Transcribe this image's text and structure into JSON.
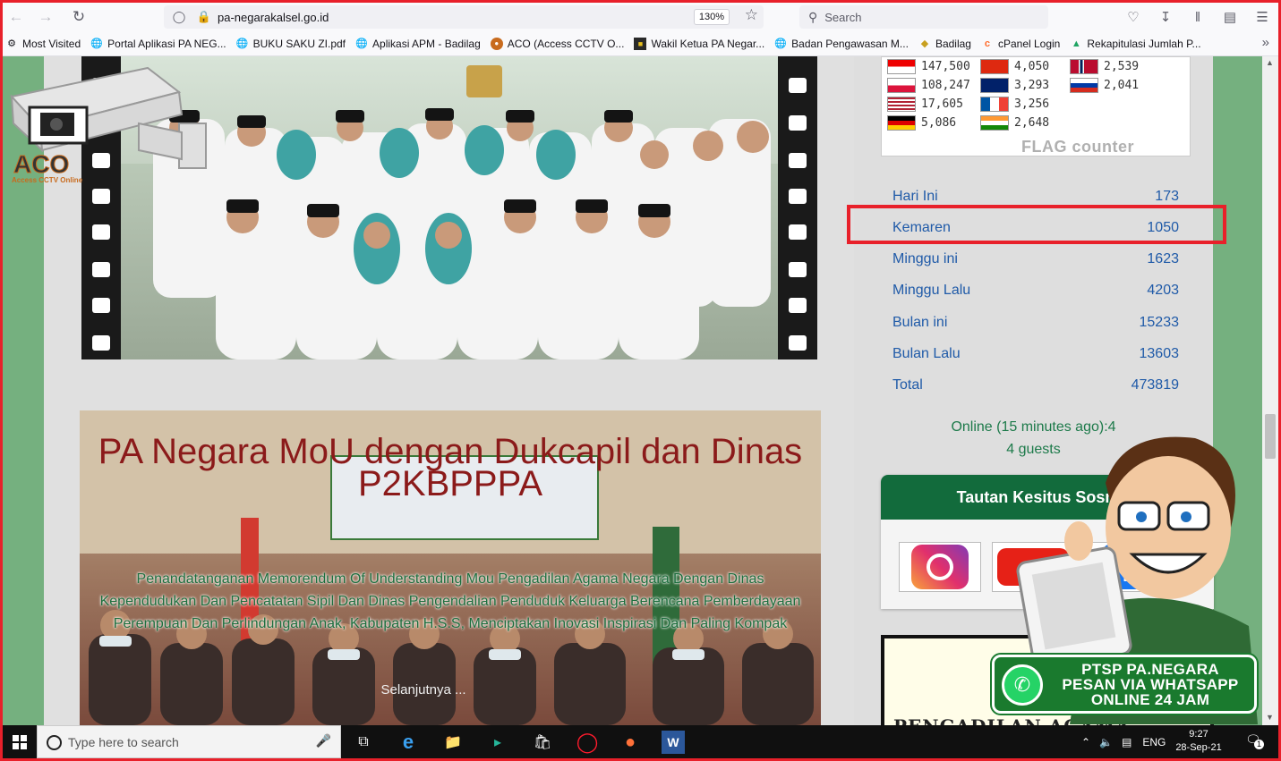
{
  "browser": {
    "url": "pa-negarakalsel.go.id",
    "zoom": "130%",
    "search_placeholder": "Search"
  },
  "bookmarks": [
    {
      "label": "Most Visited",
      "icon": "gear-icon"
    },
    {
      "label": "Portal Aplikasi PA NEG...",
      "icon": "globe-icon"
    },
    {
      "label": "BUKU SAKU ZI.pdf",
      "icon": "globe-icon"
    },
    {
      "label": "Aplikasi APM - Badilag",
      "icon": "globe-icon"
    },
    {
      "label": "ACO (Access CCTV O...",
      "icon": "aco-icon"
    },
    {
      "label": "Wakil Ketua PA Negar...",
      "icon": "site-icon"
    },
    {
      "label": "Badan Pengawasan M...",
      "icon": "globe-icon"
    },
    {
      "label": "Badilag",
      "icon": "badilag-icon"
    },
    {
      "label": "cPanel Login",
      "icon": "cpanel-icon"
    },
    {
      "label": "Rekapitulasi Jumlah P...",
      "icon": "drive-icon"
    }
  ],
  "logo": {
    "text": "ACO",
    "subtext": "Access CCTV Online"
  },
  "post": {
    "title": "PA Negara MoU dengan Dukcapil dan Dinas P2KBPPPA",
    "excerpt": "Penandatanganan Memorendum Of Understanding Mou Pengadilan Agama Negara Dengan Dinas Kependudukan Dan Pencatatan Sipil Dan Dinas Pengendalian Penduduk Keluarga Berencana Pemberdayaan Perempuan Dan Perlindungan Anak, Kabupaten H.S.S, Menciptakan Inovasi Inspirasi Dan Paling Kompak",
    "read_more": "Selanjutnya ..."
  },
  "flag_counter": {
    "rows": [
      {
        "col1": "147,500",
        "col2": "4,050",
        "col3": "2,539"
      },
      {
        "col1": "108,247",
        "col2": "3,293",
        "col3": "2,041"
      },
      {
        "col1": "17,605",
        "col2": "3,256",
        "col3": ""
      },
      {
        "col1": "5,086",
        "col2": "2,648",
        "col3": ""
      }
    ],
    "logo_text": "FLAG counter"
  },
  "stats": [
    {
      "label": "Hari Ini",
      "value": "173"
    },
    {
      "label": "Kemaren",
      "value": "1050"
    },
    {
      "label": "Minggu ini",
      "value": "1623"
    },
    {
      "label": "Minggu Lalu",
      "value": "4203"
    },
    {
      "label": "Bulan ini",
      "value": "15233"
    },
    {
      "label": "Bulan Lalu",
      "value": "13603"
    },
    {
      "label": "Total",
      "value": "473819"
    }
  ],
  "online": {
    "line1": "Online (15 minutes ago):4",
    "line2": "4 guests"
  },
  "sosmed": {
    "title": "Tautan Kesitus Sosmed"
  },
  "banner_pa": {
    "text": "PENGADILAN AGAMA NEGARA"
  },
  "whatsapp": {
    "line1": "PTSP PA.NEGARA",
    "line2": "PESAN VIA WHATSAPP",
    "line3": "ONLINE 24 JAM"
  },
  "taskbar": {
    "search_placeholder": "Type here to search",
    "lang": "ENG",
    "time": "9:27",
    "date": "28-Sep-21",
    "notif_count": "1"
  },
  "colors": {
    "accent_red": "#e8202a",
    "green": "#126b3c",
    "link_blue": "#1f5aa8"
  }
}
